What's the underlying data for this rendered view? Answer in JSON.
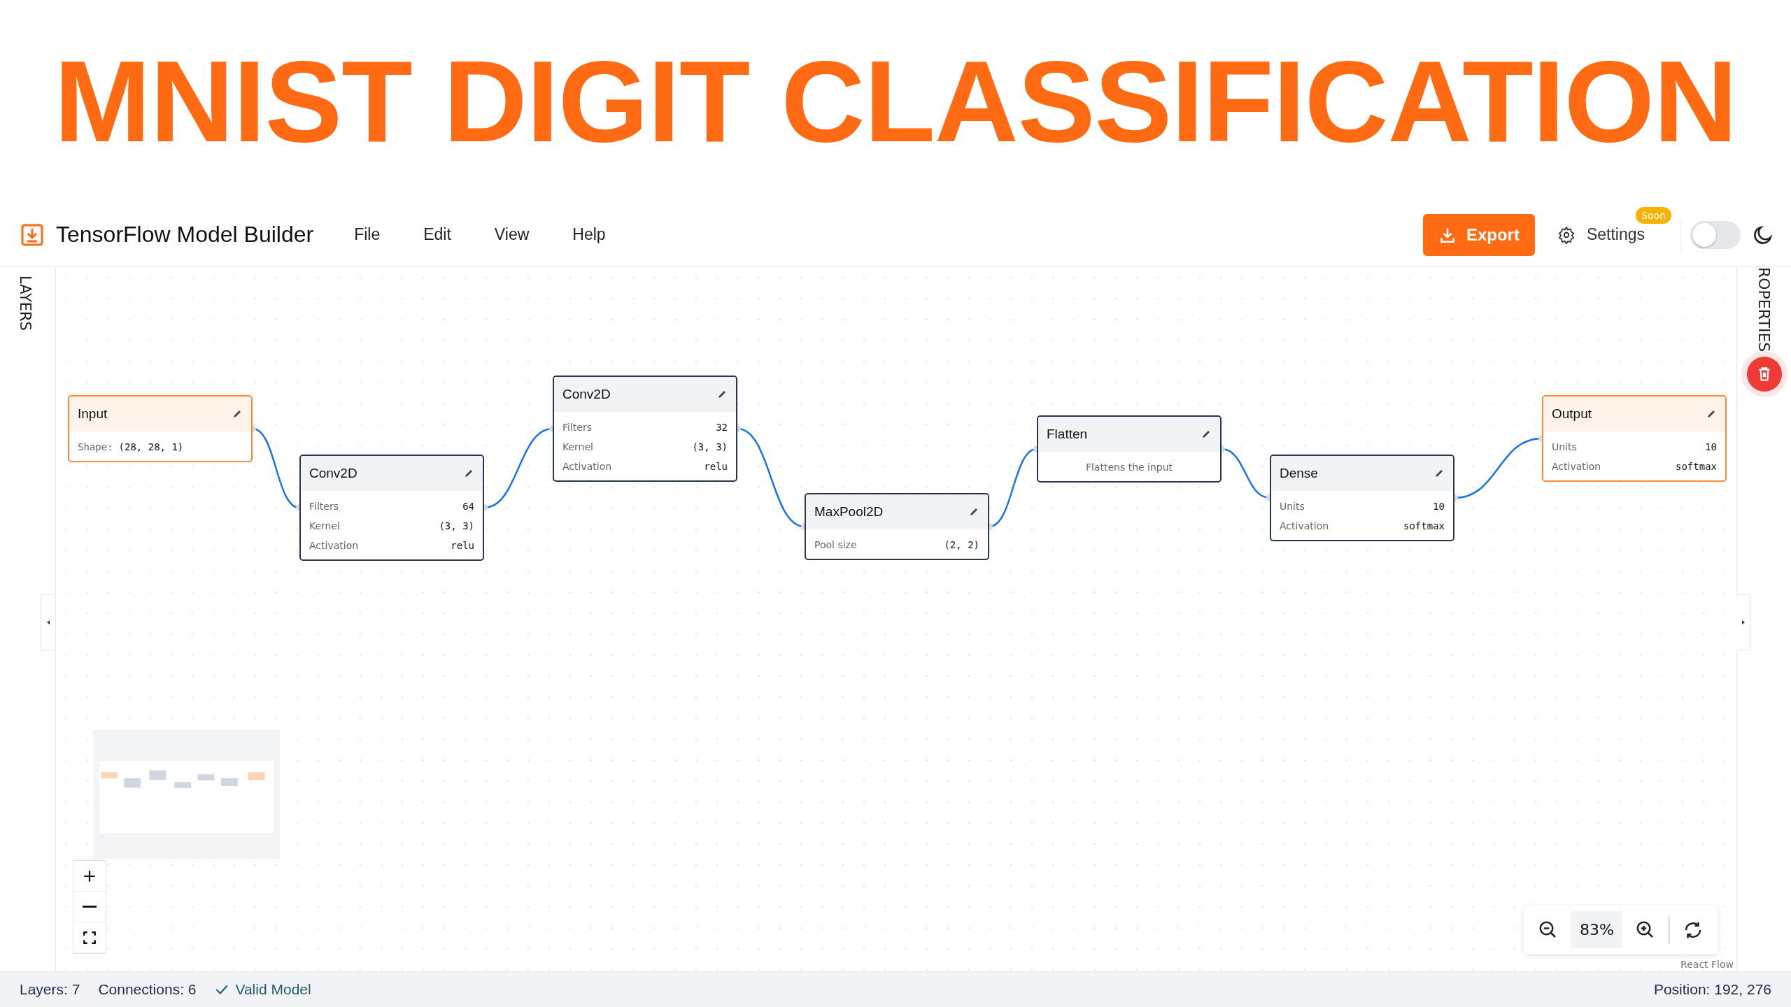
{
  "banner": {
    "title": "MNIST DIGIT CLASSIFICATION"
  },
  "header": {
    "app_title": "TensorFlow Model Builder",
    "menu": [
      "File",
      "Edit",
      "View",
      "Help"
    ],
    "export_button": "Export",
    "settings": {
      "label": "Settings",
      "badge": "Soon"
    },
    "dark_mode": {
      "on": false
    }
  },
  "sidebars": {
    "left": "LAYERS",
    "right": "ROPERTIES"
  },
  "nodes": [
    {
      "kind": "io",
      "title": "Input",
      "rows": [
        {
          "label": "Shape:",
          "value": "(28, 28, 1)"
        }
      ]
    },
    {
      "kind": "layer",
      "title": "Conv2D",
      "rows": [
        {
          "label": "Filters",
          "value": "64"
        },
        {
          "label": "Kernel",
          "value": "(3, 3)"
        },
        {
          "label": "Activation",
          "value": "relu"
        }
      ]
    },
    {
      "kind": "layer",
      "title": "Conv2D",
      "rows": [
        {
          "label": "Filters",
          "value": "32"
        },
        {
          "label": "Kernel",
          "value": "(3, 3)"
        },
        {
          "label": "Activation",
          "value": "relu"
        }
      ]
    },
    {
      "kind": "layer",
      "title": "MaxPool2D",
      "rows": [
        {
          "label": "Pool size",
          "value": "(2, 2)"
        }
      ]
    },
    {
      "kind": "layer",
      "title": "Flatten",
      "description": "Flattens the input"
    },
    {
      "kind": "layer",
      "title": "Dense",
      "rows": [
        {
          "label": "Units",
          "value": "10"
        },
        {
          "label": "Activation",
          "value": "softmax"
        }
      ]
    },
    {
      "kind": "io",
      "title": "Output",
      "rows": [
        {
          "label": "Units",
          "value": "10"
        },
        {
          "label": "Activation",
          "value": "softmax"
        }
      ]
    }
  ],
  "zoom_panel": {
    "level_text": "83%"
  },
  "attribution": "React Flow",
  "status_bar": {
    "layers": "Layers: 7",
    "connections": "Connections: 6",
    "validity": {
      "valid": true,
      "text": "Valid Model"
    },
    "position": "Position: 192, 276"
  }
}
